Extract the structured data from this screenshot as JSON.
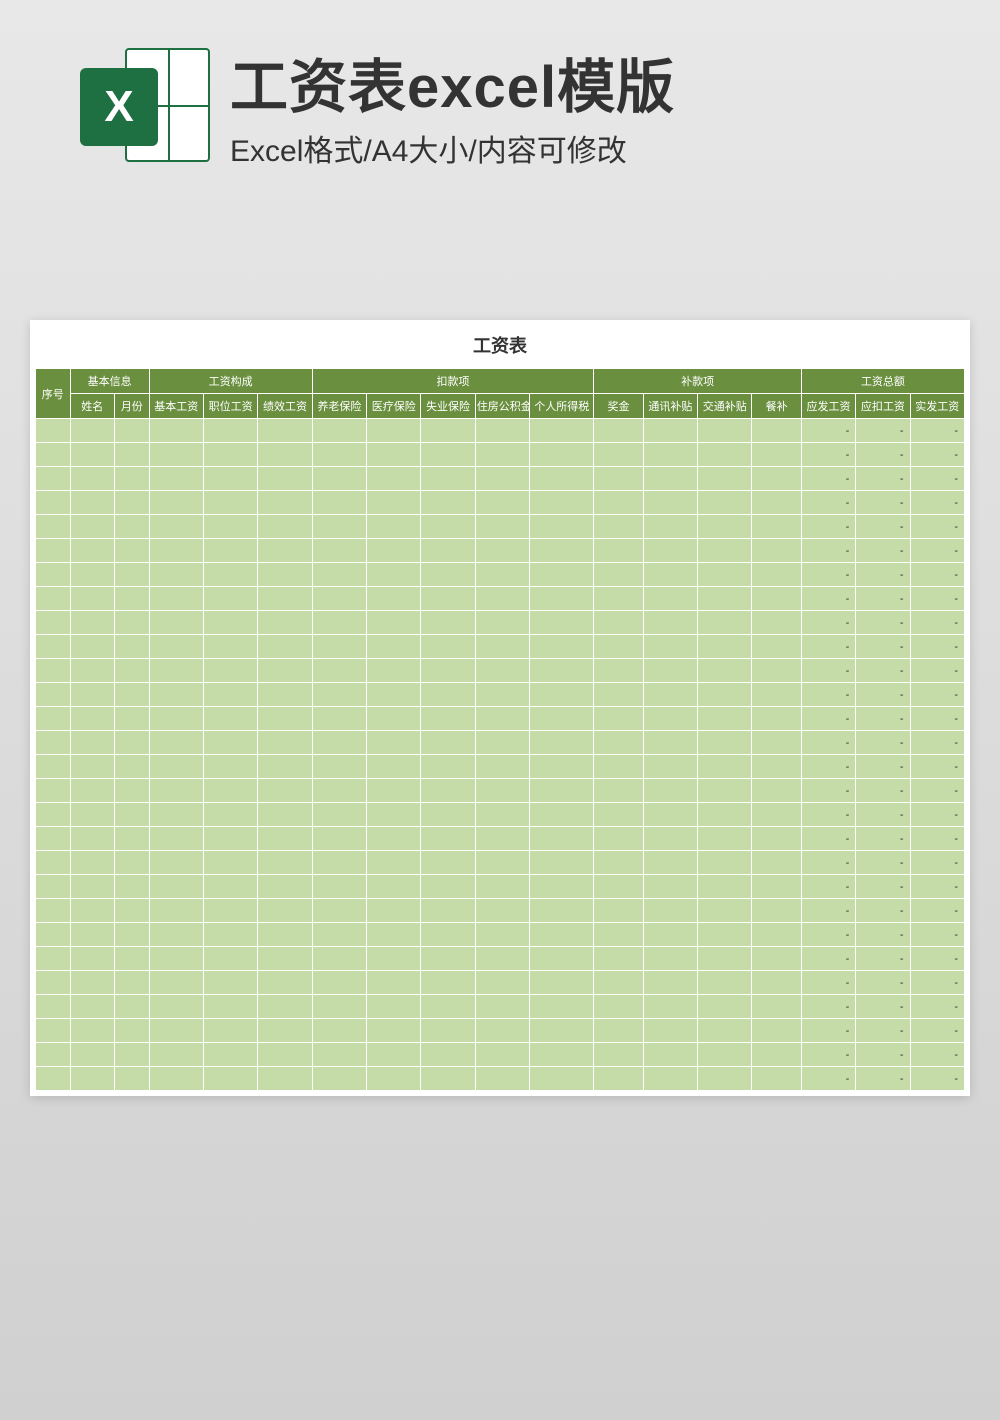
{
  "header": {
    "icon_letter": "X",
    "title": "工资表excel模版",
    "subtitle": "Excel格式/A4大小/内容可修改"
  },
  "sheet": {
    "title": "工资表",
    "groups": [
      {
        "label": "序号",
        "span": 1,
        "rowspan": 2
      },
      {
        "label": "基本信息",
        "span": 2
      },
      {
        "label": "工资构成",
        "span": 3
      },
      {
        "label": "扣款项",
        "span": 5
      },
      {
        "label": "补款项",
        "span": 4
      },
      {
        "label": "工资总额",
        "span": 3
      }
    ],
    "columns": [
      "姓名",
      "月份",
      "基本工资",
      "职位工资",
      "绩效工资",
      "养老保险",
      "医疗保险",
      "失业保险",
      "住房公积金",
      "个人所得税",
      "奖金",
      "通讯补贴",
      "交通补贴",
      "餐补",
      "应发工资",
      "应扣工资",
      "实发工资"
    ],
    "dash": "-",
    "row_count": 28,
    "total_columns": 18,
    "dash_column_indices": [
      15,
      16,
      17
    ]
  },
  "colors": {
    "header_bg": "#6a8f3f",
    "body_bg": "#c5dca8",
    "icon_green": "#1e6f42"
  }
}
